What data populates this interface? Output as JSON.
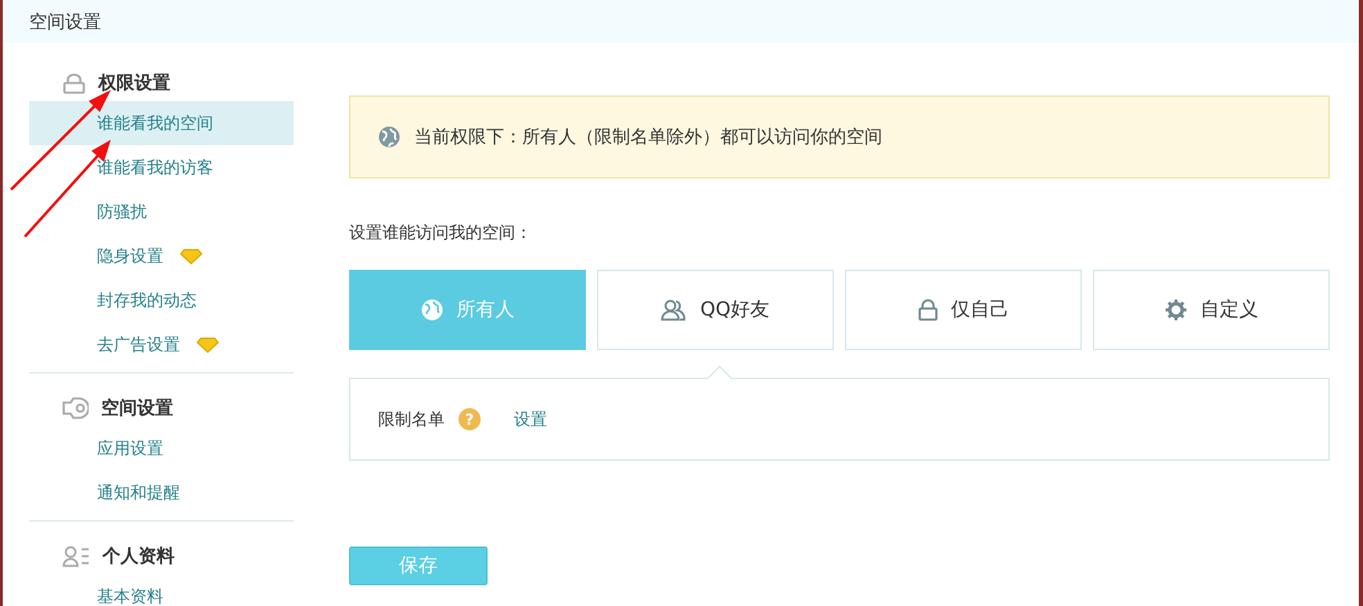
{
  "header": {
    "title": "空间设置"
  },
  "sidebar": {
    "sections": [
      {
        "kind": "lock",
        "title": "权限设置",
        "items": [
          {
            "label": "谁能看我的空间",
            "selected": true,
            "vip": false
          },
          {
            "label": "谁能看我的访客",
            "selected": false,
            "vip": false
          },
          {
            "label": "防骚扰",
            "selected": false,
            "vip": false
          },
          {
            "label": "隐身设置",
            "selected": false,
            "vip": true
          },
          {
            "label": "封存我的动态",
            "selected": false,
            "vip": false
          },
          {
            "label": "去广告设置",
            "selected": false,
            "vip": true
          }
        ]
      },
      {
        "kind": "plug",
        "title": "空间设置",
        "items": [
          {
            "label": "应用设置",
            "selected": false,
            "vip": false
          },
          {
            "label": "通知和提醒",
            "selected": false,
            "vip": false
          }
        ]
      },
      {
        "kind": "profile",
        "title": "个人资料",
        "items": [
          {
            "label": "基本资料",
            "selected": false,
            "vip": false
          }
        ]
      }
    ]
  },
  "notice": {
    "text": "当前权限下：所有人（限制名单除外）都可以访问你的空间"
  },
  "prompt": "设置谁能访问我的空间：",
  "options": [
    {
      "kind": "globe",
      "label": "所有人",
      "selected": true
    },
    {
      "kind": "friends",
      "label": "QQ好友",
      "selected": false
    },
    {
      "kind": "lock",
      "label": "仅自己",
      "selected": false
    },
    {
      "kind": "gear",
      "label": "自定义",
      "selected": false
    }
  ],
  "restrict": {
    "label": "限制名单",
    "help": "?",
    "link": "设置"
  },
  "save_button": "保存"
}
